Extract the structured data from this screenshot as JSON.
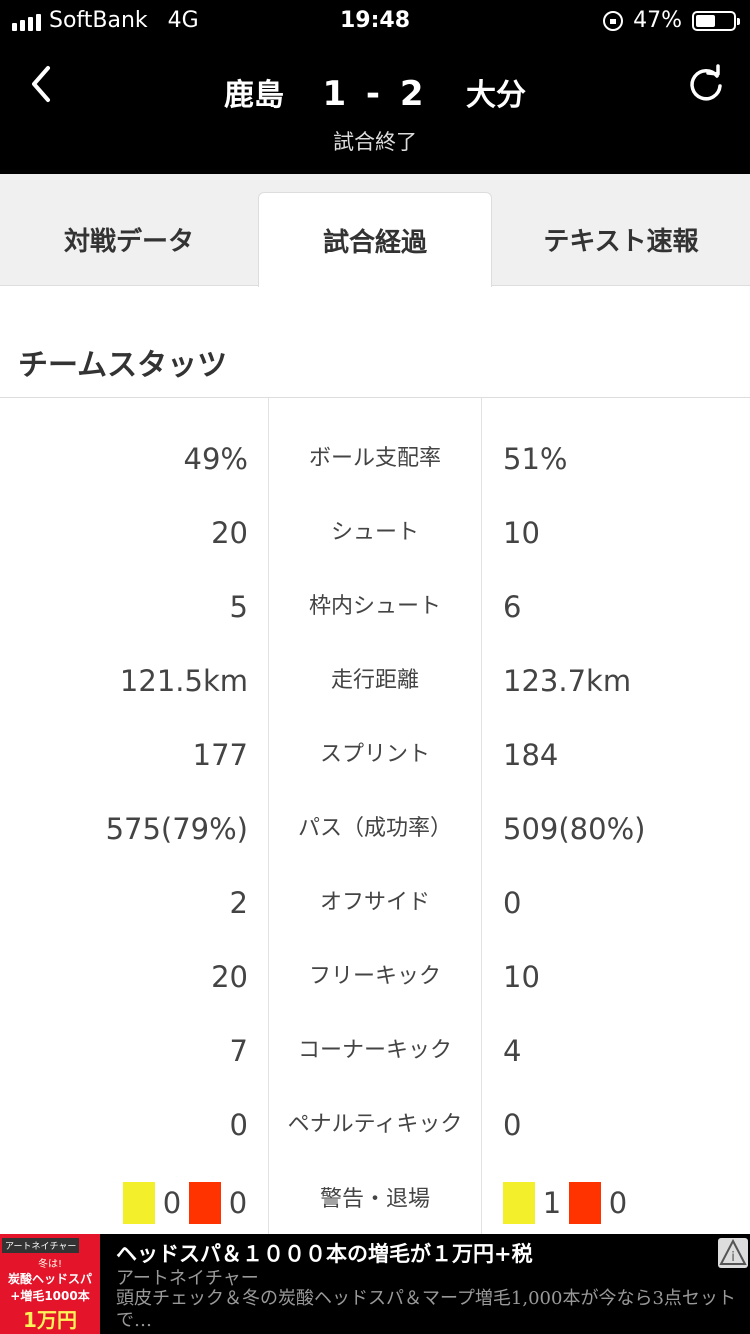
{
  "status_bar": {
    "carrier": "SoftBank",
    "network": "4G",
    "time": "19:48",
    "battery": "47%"
  },
  "header": {
    "home_team": "鹿島",
    "score": "1 - 2",
    "away_team": "大分",
    "status": "試合終了"
  },
  "tabs": [
    {
      "label": "対戦データ"
    },
    {
      "label": "試合経過"
    },
    {
      "label": "テキスト速報"
    }
  ],
  "section_title": "チームスタッツ",
  "stats": [
    {
      "left": "49%",
      "label": "ボール支配率",
      "right": "51%"
    },
    {
      "left": "20",
      "label": "シュート",
      "right": "10"
    },
    {
      "left": "5",
      "label": "枠内シュート",
      "right": "6"
    },
    {
      "left": "121.5km",
      "label": "走行距離",
      "right": "123.7km"
    },
    {
      "left": "177",
      "label": "スプリント",
      "right": "184"
    },
    {
      "left": "575(79%)",
      "label": "パス（成功率）",
      "right": "509(80%)"
    },
    {
      "left": "2",
      "label": "オフサイド",
      "right": "0"
    },
    {
      "left": "20",
      "label": "フリーキック",
      "right": "10"
    },
    {
      "left": "7",
      "label": "コーナーキック",
      "right": "4"
    },
    {
      "left": "0",
      "label": "ペナルティキック",
      "right": "0"
    }
  ],
  "cards": {
    "label": "警告・退場",
    "home_yellow": "0",
    "home_red": "0",
    "away_yellow": "1",
    "away_red": "0",
    "yellow_color": "#f3ef2a",
    "red_color": "#ff3300"
  },
  "ad": {
    "image_brand": "アートネイチャー",
    "image_line1": "冬は!",
    "image_line2": "炭酸ヘッドスパ",
    "image_line3": "+増毛1000本",
    "image_price": "1万円",
    "headline": "ヘッドスパ＆１０００本の増毛が１万円+税",
    "sponsor": "アートネイチャー",
    "body": "頭皮チェック＆冬の炭酸ヘッドスパ＆マープ増毛1,000本が今なら3点セットで…"
  }
}
